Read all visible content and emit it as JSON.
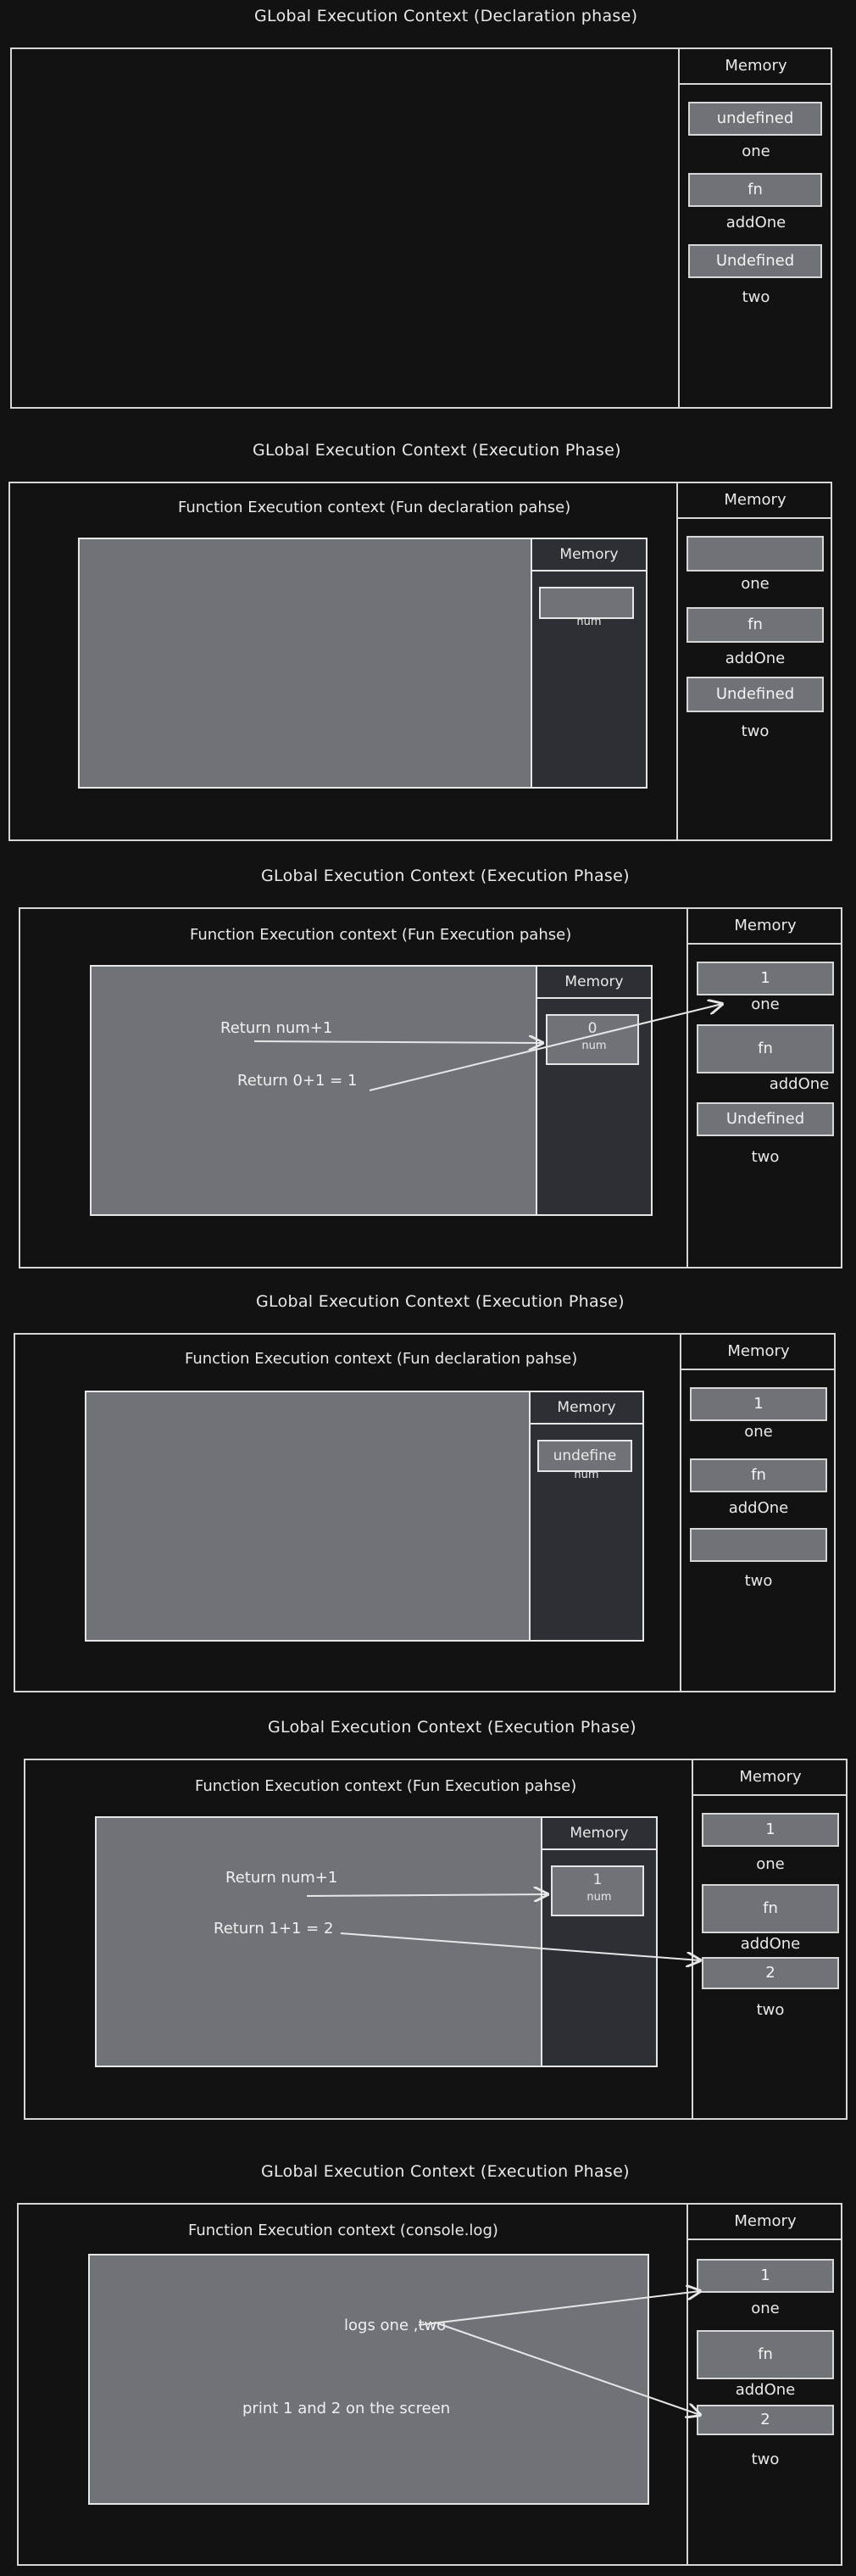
{
  "memory_header": "Memory",
  "fn_memory_header": "Memory",
  "panels": [
    {
      "title": "GLobal Execution Context (Declaration phase)",
      "globals": [
        {
          "value": "undefined",
          "label": "one"
        },
        {
          "value": "fn",
          "label": "addOne"
        },
        {
          "value": "Undefined",
          "label": "two"
        }
      ]
    },
    {
      "title": "GLobal Execution Context (Execution Phase)",
      "fn_title": "Function Execution context (Fun declaration pahse)",
      "slot_value": "",
      "slot_label": "num",
      "globals": [
        {
          "value": "",
          "label": "one"
        },
        {
          "value": "fn",
          "label": "addOne"
        },
        {
          "value": "Undefined",
          "label": "two"
        }
      ]
    },
    {
      "title": "GLobal Execution Context (Execution Phase)",
      "fn_title": "Function Execution context (Fun Execution pahse)",
      "slot_value": "0",
      "slot_label": "num",
      "notes": [
        "Return num+1",
        "Return 0+1 = 1"
      ],
      "globals": [
        {
          "value": "1",
          "label": "one"
        },
        {
          "value": "fn",
          "label": "addOne"
        },
        {
          "value": "Undefined",
          "label": "two"
        }
      ]
    },
    {
      "title": "GLobal Execution Context (Execution Phase)",
      "fn_title": "Function Execution context (Fun declaration pahse)",
      "slot_value": "undefine",
      "slot_label": "num",
      "globals": [
        {
          "value": "1",
          "label": "one"
        },
        {
          "value": "fn",
          "label": "addOne"
        },
        {
          "value": "",
          "label": "two"
        }
      ]
    },
    {
      "title": "GLobal Execution Context (Execution Phase)",
      "fn_title": "Function Execution context (Fun Execution pahse)",
      "slot_value": "1",
      "slot_label": "num",
      "notes": [
        "Return num+1",
        "Return 1+1 = 2"
      ],
      "globals": [
        {
          "value": "1",
          "label": "one"
        },
        {
          "value": "fn",
          "label": "addOne"
        },
        {
          "value": "2",
          "label": "two"
        }
      ]
    },
    {
      "title": "GLobal Execution Context (Execution Phase)",
      "fn_title": "Function Execution context (console.log)",
      "notes": [
        "logs one ,two",
        "print 1 and 2 on the screen"
      ],
      "globals": [
        {
          "value": "1",
          "label": "one"
        },
        {
          "value": "fn",
          "label": "addOne"
        },
        {
          "value": "2",
          "label": "two"
        }
      ]
    }
  ]
}
